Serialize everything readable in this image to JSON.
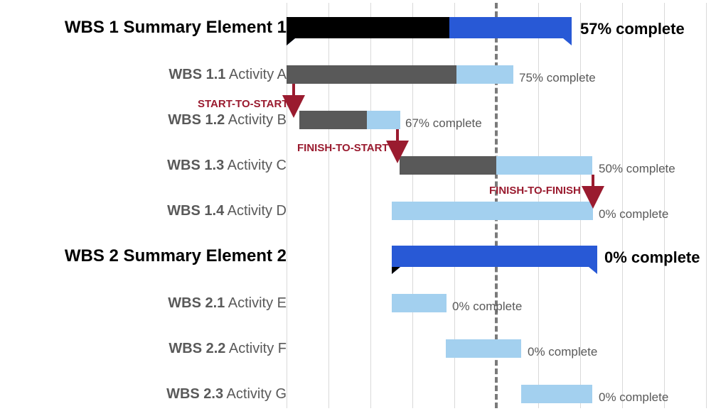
{
  "chart_data": {
    "type": "gantt",
    "time_axis": {
      "start": 0,
      "end": 10,
      "today": 5.0
    },
    "groups": [
      {
        "id": "wbs1",
        "wbs": "WBS 1",
        "name": "Summary Element 1",
        "type": "summary",
        "start": 0,
        "end": 6.8,
        "percent_complete": 57,
        "completion_label": "57% complete",
        "tasks": [
          {
            "id": "a",
            "wbs": "WBS 1.1",
            "name": "Activity A",
            "start": 0,
            "end": 5.4,
            "percent_complete": 75,
            "completion_label": "75% complete"
          },
          {
            "id": "b",
            "wbs": "WBS 1.2",
            "name": "Activity B",
            "start": 0.3,
            "end": 2.7,
            "percent_complete": 67,
            "completion_label": "67% complete"
          },
          {
            "id": "c",
            "wbs": "WBS 1.3",
            "name": "Activity C",
            "start": 2.7,
            "end": 7.3,
            "percent_complete": 50,
            "completion_label": "50% complete"
          },
          {
            "id": "d",
            "wbs": "WBS 1.4",
            "name": "Activity D",
            "start": 2.5,
            "end": 7.3,
            "percent_complete": 0,
            "completion_label": "0% complete"
          }
        ]
      },
      {
        "id": "wbs2",
        "wbs": "WBS 2",
        "name": "Summary Element 2",
        "type": "summary",
        "start": 2.5,
        "end": 7.4,
        "percent_complete": 0,
        "completion_label": "0% complete",
        "tasks": [
          {
            "id": "e",
            "wbs": "WBS 2.1",
            "name": "Activity E",
            "start": 2.5,
            "end": 3.8,
            "percent_complete": 0,
            "completion_label": "0% complete"
          },
          {
            "id": "f",
            "wbs": "WBS 2.2",
            "name": "Activity F",
            "start": 3.8,
            "end": 5.6,
            "percent_complete": 0,
            "completion_label": "0% complete"
          },
          {
            "id": "g",
            "wbs": "WBS 2.3",
            "name": "Activity G",
            "start": 5.6,
            "end": 7.3,
            "percent_complete": 0,
            "completion_label": "0% complete"
          }
        ]
      }
    ],
    "dependencies": [
      {
        "type": "start-to-start",
        "label": "START-TO-START",
        "from": "a",
        "to": "b"
      },
      {
        "type": "finish-to-start",
        "label": "FINISH-TO-START",
        "from": "b",
        "to": "c"
      },
      {
        "type": "finish-to-finish",
        "label": "FINISH-TO-FINISH",
        "from": "c",
        "to": "d"
      }
    ]
  },
  "colors": {
    "summary_bar": "#2859d6",
    "summary_progress": "#000000",
    "activity_bar": "#a3d0ef",
    "activity_progress": "#595959",
    "dep_arrow": "#9a1b2f"
  },
  "rows": {
    "r0": {
      "wbs": "WBS 1",
      "name": " Summary Element 1",
      "completion": "57% complete"
    },
    "r1": {
      "wbs": "WBS 1.1",
      "name": " Activity A",
      "completion": "75% complete"
    },
    "r2": {
      "wbs": "WBS 1.2",
      "name": " Activity B",
      "completion": "67% complete"
    },
    "r3": {
      "wbs": "WBS 1.3",
      "name": " Activity C",
      "completion": "50% complete"
    },
    "r4": {
      "wbs": "WBS 1.4",
      "name": " Activity D",
      "completion": "0% complete"
    },
    "r5": {
      "wbs": "WBS 2",
      "name": " Summary Element 2",
      "completion": "0% complete"
    },
    "r6": {
      "wbs": "WBS 2.1",
      "name": " Activity E",
      "completion": "0% complete"
    },
    "r7": {
      "wbs": "WBS 2.2",
      "name": " Activity F",
      "completion": "0% complete"
    },
    "r8": {
      "wbs": "WBS 2.3",
      "name": " Activity G",
      "completion": "0% complete"
    }
  },
  "deps": {
    "ss": "START-TO-START",
    "fs": "FINISH-TO-START",
    "ff": "FINISH-TO-FINISH"
  }
}
